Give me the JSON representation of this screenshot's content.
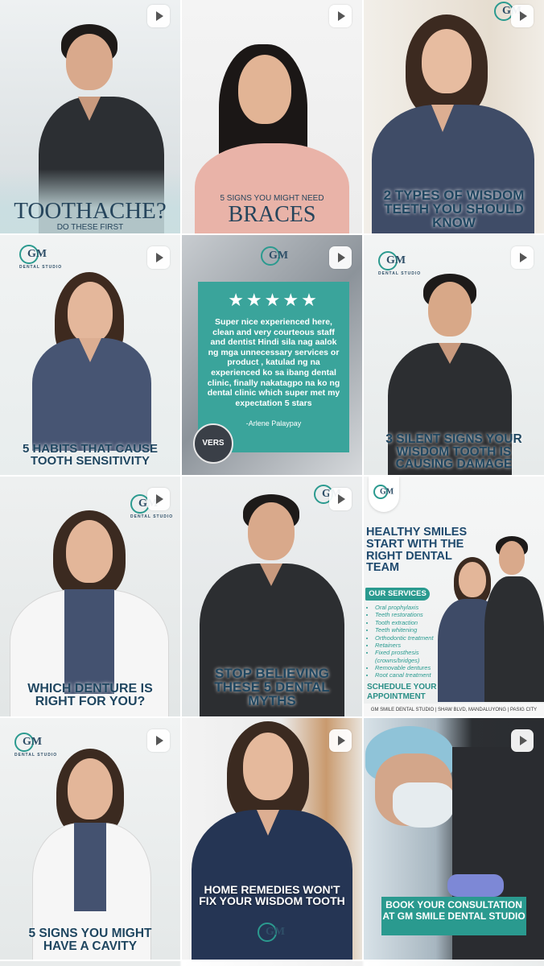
{
  "tiles": [
    {
      "caption_line1": "TOOTHACHE?",
      "caption_line2": "DO THESE FIRST"
    },
    {
      "caption_line1": "5 SIGNS YOU MIGHT NEED",
      "caption_line2": "BRACES"
    },
    {
      "caption": "2 TYPES OF WISDOM TEETH YOU SHOULD KNOW",
      "logo_text": "GM"
    },
    {
      "caption": "5 HABITS THAT CAUSE TOOTH SENSITIVITY",
      "logo_text": "GM",
      "logo_sub": "DENTAL STUDIO"
    },
    {
      "review": {
        "stars": "★★★★★",
        "text": "Super nice experienced here, clean and very courteous staff and dentist Hindi sila nag aalok ng mga unnecessary services or product , katulad ng na experienced ko sa ibang dental clinic, finally nakatagpo na ko ng dental clinic which super met my expectation 5 stars",
        "author": "-Arlene Palaypay"
      },
      "logo_text": "GM"
    },
    {
      "caption": "3 SILENT SIGNS YOUR WISDOM TOOTH IS CAUSING DAMAGE",
      "logo_text": "GM",
      "logo_sub": "DENTAL STUDIO"
    },
    {
      "caption": "WHICH DENTURE IS RIGHT FOR YOU?",
      "logo_text": "GM",
      "logo_sub": "DENTAL STUDIO"
    },
    {
      "caption": "STOP BELIEVING THESE 5 DENTAL MYTHS",
      "logo_text": "GM"
    },
    {
      "headline": "HEALTHY SMILES START WITH THE RIGHT DENTAL TEAM",
      "services_title": "OUR SERVICES",
      "services": [
        "Oral prophylaxis",
        "Teeth restorations",
        "Tooth extraction",
        "Teeth whitening",
        "Orthodontic treatment",
        "Retainers",
        "Fixed prosthesis (crowns/bridges)",
        "Removable dentures",
        "Root canal treatment"
      ],
      "cta": "SCHEDULE YOUR APPOINTMENT",
      "footer": "GM SMILE DENTAL STUDIO  |  SHAW BLVD, MANDALUYONG | PASIG CITY",
      "logo_text": "GM"
    },
    {
      "caption": "5 SIGNS YOU MIGHT HAVE A CAVITY",
      "logo_text": "GM",
      "logo_sub": "DENTAL STUDIO"
    },
    {
      "caption": "HOME REMEDIES WON'T FIX YOUR WISDOM TOOTH",
      "logo_text": "GM"
    },
    {
      "caption": "BOOK YOUR CONSULTATION AT GM SMILE DENTAL STUDIO"
    }
  ],
  "reviewer_avatar_text": "VERS"
}
